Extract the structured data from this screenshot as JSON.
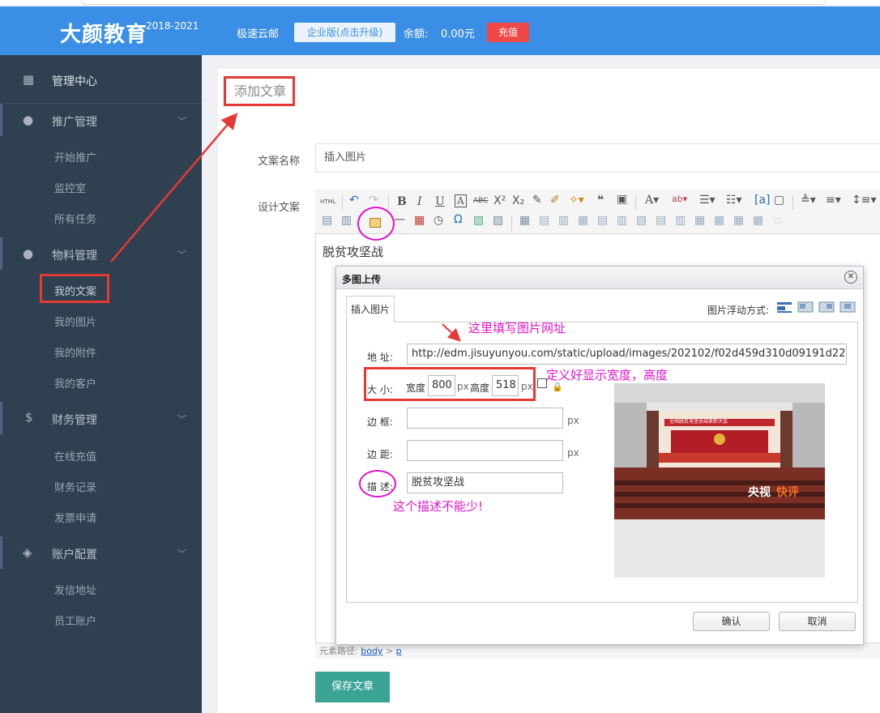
{
  "header": {
    "brand": "大颜教育",
    "brand_year": "2018-2021",
    "service": "极速云邮",
    "upgrade_button": "企业版(点击升级)",
    "balance_label": "余额:",
    "balance_value": "0.00元",
    "recharge_button": "充值"
  },
  "sidebar": {
    "top": "管理中心",
    "groups": [
      {
        "label": "推广管理",
        "items": [
          "开始推广",
          "监控室",
          "所有任务"
        ]
      },
      {
        "label": "物料管理",
        "items": [
          "我的文案",
          "我的图片",
          "我的附件",
          "我的客户"
        ]
      },
      {
        "label": "财务管理",
        "items": [
          "在线充值",
          "财务记录",
          "发票申请"
        ]
      },
      {
        "label": "账户配置",
        "items": [
          "发信地址",
          "员工账户"
        ]
      }
    ],
    "active_item": "我的文案"
  },
  "page": {
    "title": "添加文章",
    "name_label": "文案名称",
    "name_value": "插入图片",
    "design_label": "设计文案",
    "editor_text": "脱贫攻坚战",
    "path_label": "元素路径:",
    "path_body": "body",
    "path_sep": ">",
    "path_p": "p",
    "save_button": "保存文章"
  },
  "dialog": {
    "title": "多图上传",
    "tab": "插入图片",
    "float_label": "图片浮动方式:",
    "address_label": "地 址:",
    "address_value": "http://edm.jisuyunyou.com/static/upload/images/202102/f02d459d310d09191d22",
    "size_label": "大 小:",
    "width_label": "宽度",
    "width_value": "800",
    "height_label": "高度",
    "height_value": "518",
    "px": "px",
    "border_label": "边 框:",
    "margin_label": "边 距:",
    "desc_label": "描 述:",
    "desc_value": "脱贫攻坚战",
    "confirm_button": "确认",
    "cancel_button": "取消",
    "preview_banner": "全国脱贫攻坚总结表彰大会",
    "preview_watermark": "央视",
    "preview_watermark_2": "快评"
  },
  "annotations": {
    "address_hint": "这里填写图片网址",
    "size_hint": "定义好显示宽度，高度",
    "desc_hint": "这个描述不能少!"
  },
  "colors": {
    "header": "#3a8ee6",
    "sidebar": "#2f4050",
    "save": "#3aa394",
    "recharge": "#f04747",
    "annotation_red": "#e53935",
    "annotation_magenta": "#e016c9"
  }
}
